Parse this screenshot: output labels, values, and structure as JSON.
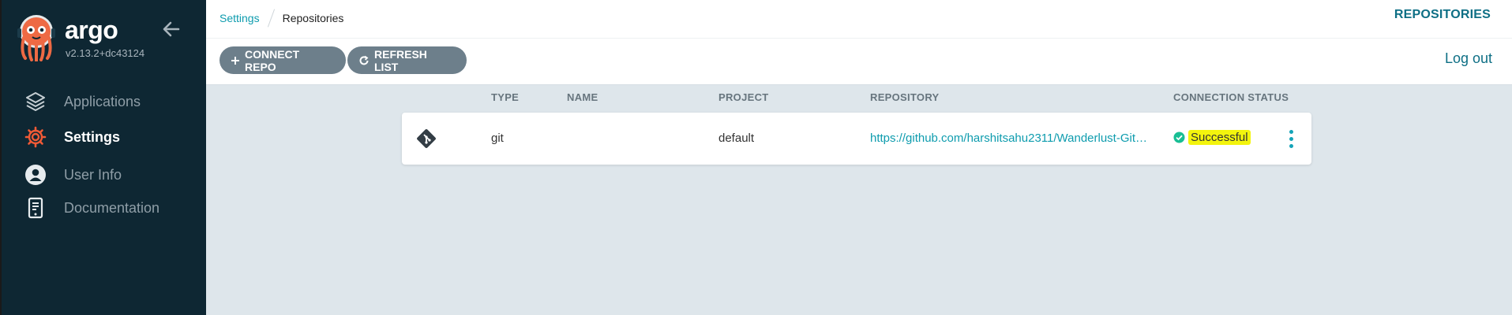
{
  "sidebar": {
    "brand": "argo",
    "version": "v2.13.2+dc43124",
    "items": [
      {
        "label": "Applications",
        "icon": "layers-icon"
      },
      {
        "label": "Settings",
        "icon": "gear-icon",
        "active": true
      },
      {
        "label": "User Info",
        "icon": "user-icon"
      },
      {
        "label": "Documentation",
        "icon": "docs-icon"
      }
    ]
  },
  "breadcrumb": {
    "parent": "Settings",
    "current": "Repositories"
  },
  "header": {
    "title": "REPOSITORIES",
    "logout": "Log out"
  },
  "toolbar": {
    "connect_label": "CONNECT REPO",
    "refresh_label": "REFRESH LIST"
  },
  "table": {
    "headers": {
      "type": "TYPE",
      "name": "NAME",
      "project": "PROJECT",
      "repository": "REPOSITORY",
      "status": "CONNECTION STATUS"
    },
    "rows": [
      {
        "icon": "git-icon",
        "type": "git",
        "name": "",
        "project": "default",
        "repository": "https://github.com/harshitsahu2311/Wanderlust-Git…",
        "status": "Successful"
      }
    ]
  },
  "colors": {
    "accent": "#0e9cae",
    "sidebar": "#0e2733",
    "success": "#18be94",
    "highlight": "#f3f40d",
    "active_icon": "#f05a36"
  }
}
